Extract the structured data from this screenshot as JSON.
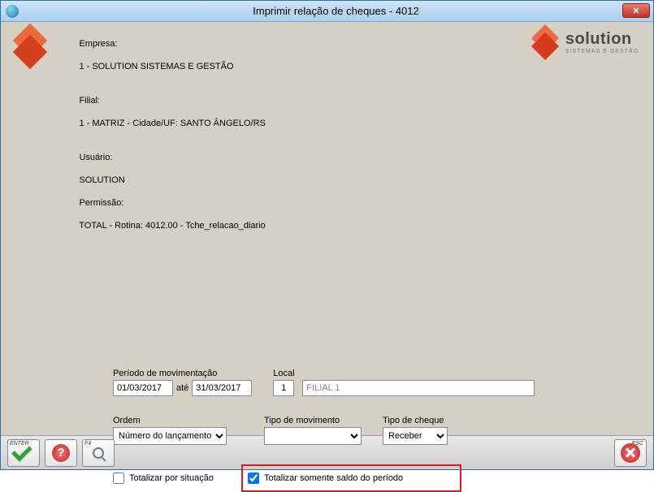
{
  "window": {
    "title": "Imprimir relação de cheques - 4012"
  },
  "header": {
    "empresa_label": "Empresa:",
    "empresa": "1 - SOLUTION SISTEMAS E GESTÃO",
    "filial_label": "Filial:",
    "filial": "1 - MATRIZ - Cidade/UF: SANTO ÂNGELO/RS",
    "usuario_label": "Usuário:",
    "usuario": "SOLUTION",
    "permissao_label": "Permissão:",
    "permissao": "TOTAL - Rotina: 4012.00 - Tche_relacao_diario"
  },
  "brand": {
    "name": "solution",
    "tagline": "SISTEMAS E GESTÃO"
  },
  "form": {
    "periodo_label": "Período de movimentação",
    "periodo_de": "01/03/2017",
    "periodo_ate_label": "até",
    "periodo_ate": "31/03/2017",
    "local_label": "Local",
    "local_id": "1",
    "local_name": "FILIAL 1",
    "ordem_label": "Ordem",
    "ordem_value": "Número do lançamento",
    "tipo_mov_label": "Tipo de movimento",
    "tipo_mov_value": "",
    "tipo_cheque_label": "Tipo de cheque",
    "tipo_cheque_value": "Receber",
    "chk_situacao_label": "Totalizar por situação",
    "chk_situacao_checked": false,
    "chk_saldo_label": "Totalizar somente saldo do período",
    "chk_saldo_checked": true
  },
  "footer": {
    "enter_tag": "ENTER",
    "f4_tag": "F4",
    "esc_tag": "ESC"
  }
}
